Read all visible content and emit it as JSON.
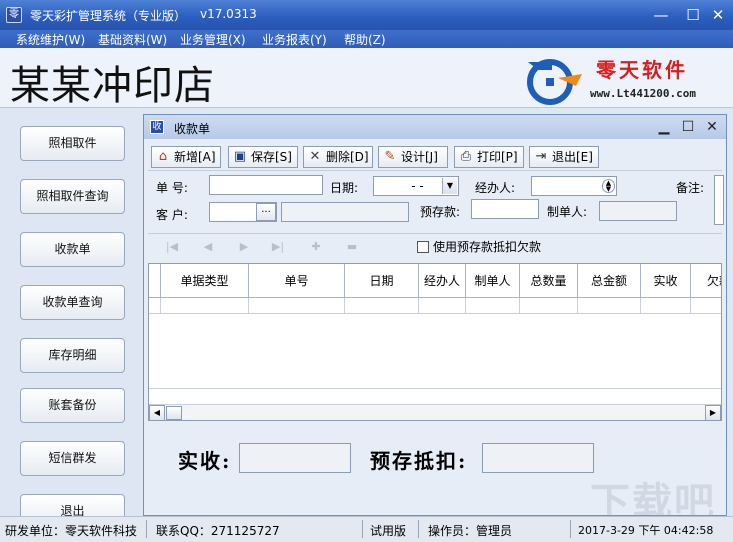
{
  "window": {
    "title": "零天彩扩管理系统（专业版）",
    "version": "v17.0313",
    "icon": "app-icon"
  },
  "menu": [
    "系统维护(W)",
    "基础资料(W)",
    "业务管理(X)",
    "业务报表(Y)",
    "帮助(Z)"
  ],
  "banner": {
    "store_name": "某某冲印店",
    "brand": "零天软件",
    "url": "www.Lt441200.com"
  },
  "sidebar": [
    "照相取件",
    "照相取件查询",
    "收款单",
    "收款单查询",
    "库存明细",
    "账套备份",
    "短信群发",
    "退出"
  ],
  "child": {
    "title": "收款单",
    "toolbar": [
      {
        "label": "新增[A]",
        "icon": "add-icon"
      },
      {
        "label": "保存[S]",
        "icon": "save-icon"
      },
      {
        "label": "删除[D]",
        "icon": "delete-icon"
      },
      {
        "label": "设计[J]",
        "icon": "design-icon"
      },
      {
        "label": "打印[P]",
        "icon": "print-icon"
      },
      {
        "label": "退出[E]",
        "icon": "exit-icon"
      }
    ],
    "form": {
      "number_label": "单  号:",
      "date_label": "日期:",
      "date_value": "- -",
      "handler_label": "经办人:",
      "notes_label": "备注:",
      "customer_label": "客  户:",
      "customer_button": "...",
      "prepaid_label": "预存款:",
      "creator_label": "制单人:"
    },
    "use_prepaid_label": "使用预存款抵扣欠款",
    "grid_columns": [
      "单据类型",
      "单号",
      "日期",
      "经办人",
      "制单人",
      "总数量",
      "总金额",
      "实收",
      "欠款"
    ],
    "totals": {
      "received_label": "实收:",
      "prepaid_deduct_label": "预存抵扣:"
    }
  },
  "status": {
    "developer": "研发单位：零天软件科技",
    "qq": "联系QQ：271125727",
    "edition": "试用版",
    "operator": "操作员：管理员",
    "datetime": "2017-3-29  下午  04:42:58"
  },
  "colors": {
    "titlebar": "#2c5fbf",
    "brand_red": "#d71f1f",
    "background": "#dfe7f3"
  }
}
